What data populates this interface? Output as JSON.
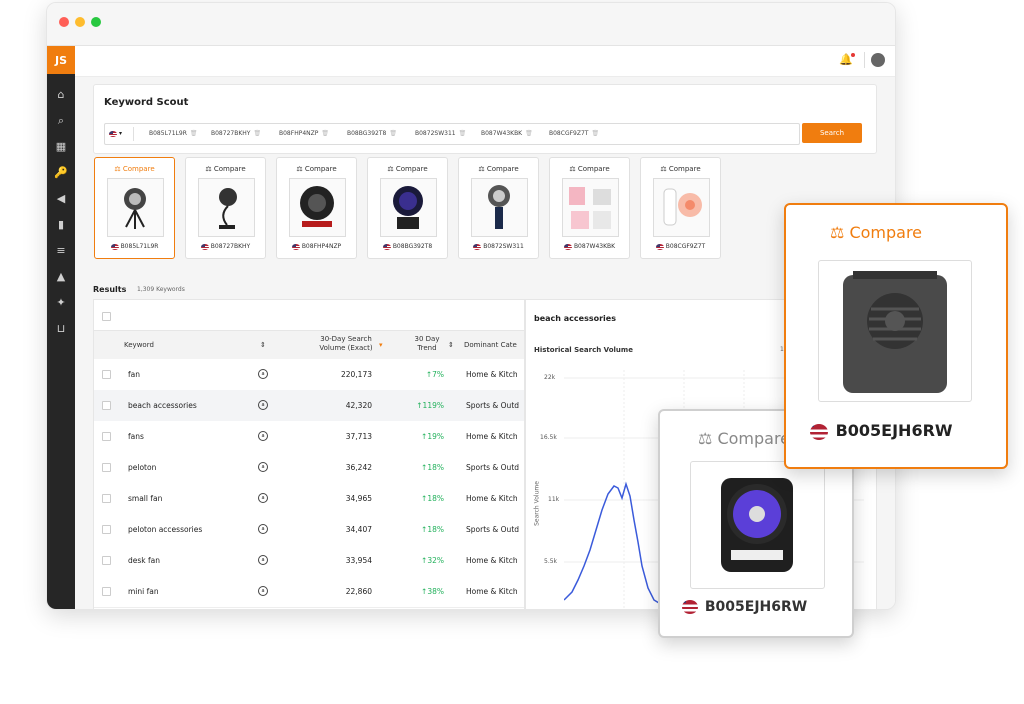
{
  "app": {
    "logo": "JS"
  },
  "keyword_scout": {
    "title": "Keyword Scout",
    "asin_chips": [
      "B085L71L9R",
      "B08727BKHY",
      "B08FHP4NZP",
      "B08BG392T8",
      "B0872SW311",
      "B087W43KBK",
      "B08CGF9Z7T"
    ],
    "search_label": "Search"
  },
  "products": [
    {
      "compare": "Compare",
      "asin": "B085L71L9R"
    },
    {
      "compare": "Compare",
      "asin": "B08727BKHY"
    },
    {
      "compare": "Compare",
      "asin": "B08FHP4NZP"
    },
    {
      "compare": "Compare",
      "asin": "B08BG392T8"
    },
    {
      "compare": "Compare",
      "asin": "B0872SW311"
    },
    {
      "compare": "Compare",
      "asin": "B087W43KBK"
    },
    {
      "compare": "Compare",
      "asin": "B08CGF9Z7T"
    }
  ],
  "results": {
    "title": "Results",
    "count": "1,309 Keywords",
    "headers": {
      "keyword": "Keyword",
      "volume_line1": "30-Day Search",
      "volume_line2": "Volume (Exact)",
      "trend_line1": "30 Day",
      "trend_line2": "Trend",
      "category": "Dominant Cate"
    },
    "rows": [
      {
        "keyword": "fan",
        "volume": "220,173",
        "trend": "↑7%",
        "category": "Home & Kitch"
      },
      {
        "keyword": "beach accessories",
        "volume": "42,320",
        "trend": "↑119%",
        "category": "Sports & Outd"
      },
      {
        "keyword": "fans",
        "volume": "37,713",
        "trend": "↑19%",
        "category": "Home & Kitch"
      },
      {
        "keyword": "peloton",
        "volume": "36,242",
        "trend": "↑18%",
        "category": "Sports & Outd"
      },
      {
        "keyword": "small fan",
        "volume": "34,965",
        "trend": "↑18%",
        "category": "Home & Kitch"
      },
      {
        "keyword": "peloton accessories",
        "volume": "34,407",
        "trend": "↑18%",
        "category": "Sports & Outd"
      },
      {
        "keyword": "desk fan",
        "volume": "33,954",
        "trend": "↑32%",
        "category": "Home & Kitch"
      },
      {
        "keyword": "mini fan",
        "volume": "22,860",
        "trend": "↑38%",
        "category": "Home & Kitch"
      }
    ]
  },
  "chart": {
    "title": "beach accessories",
    "subtitle": "Historical Search Volume",
    "ylabel": "Search Volume",
    "right_label": "1!",
    "yticks": [
      "22k",
      "16.5k",
      "11k",
      "5.5k"
    ]
  },
  "overlay_big": {
    "compare": "Compare",
    "asin": "B005EJH6RW"
  },
  "overlay_mid": {
    "compare": "Compare",
    "asin": "B005EJH6RW"
  },
  "colors": {
    "accent": "#f07d0f",
    "trend_up": "#20b05a",
    "line": "#3b5bdb"
  }
}
